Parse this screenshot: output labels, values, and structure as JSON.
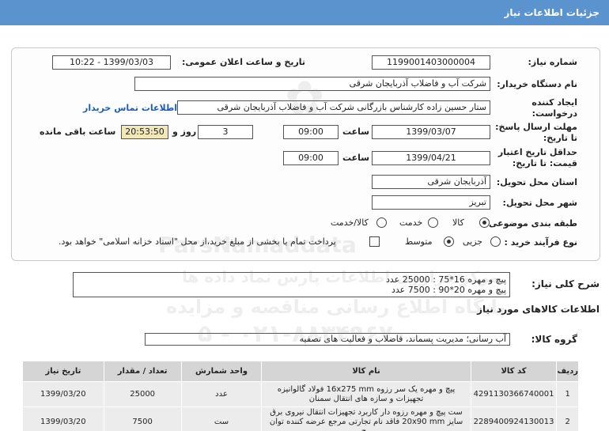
{
  "header": {
    "title": "جزئیات اطلاعات نیاز"
  },
  "form": {
    "need_number_label": "شماره نیاز:",
    "need_number": "1199001403000004",
    "announce_label": "تاریخ و ساعت اعلان عمومی:",
    "announce_value": "1399/03/03 - 10:22",
    "buyer_label": "نام دستگاه خریدار:",
    "buyer_value": "شرکت آب و فاضلاب آذربایجان شرقی",
    "creator_label_1": "ایجاد کننده",
    "creator_label_2": "درخواست:",
    "creator_value": "ستار حسین زاده کارشناس بازرگانی شرکت آب و فاضلاب آذربایجان شرقی",
    "contact_link": "اطلاعات تماس خریدار",
    "reply_label_1": "مهلت ارسال پاسخ:",
    "reply_label_2": "تا تاریخ:",
    "reply_date": "1399/03/07",
    "time_label": "ساعت",
    "reply_time": "09:00",
    "days_value": "3",
    "days_label": "روز و",
    "remaining_time": "20:53:50",
    "remaining_label": "ساعت باقی مانده",
    "validity_label_1": "حداقل تاریخ اعتبار",
    "validity_label_2": "قیمت: تا تاریخ:",
    "validity_date": "1399/04/21",
    "validity_time": "09:00",
    "province_label": "استان محل تحویل:",
    "province_value": "آذربایجان شرقی",
    "city_label": "شهر محل تحویل:",
    "city_value": "تبریز",
    "category_label": "طبقه بندی موضوعی:",
    "category_options": [
      "کالا",
      "خدمت",
      "کالا/خدمت"
    ],
    "process_label": "نوع فرآیند خرید :",
    "process_options": [
      "جزیی",
      "متوسط"
    ],
    "treasury_note": "پرداخت تمام یا بخشی از مبلغ خرید،از محل \"اسناد خزانه اسلامی\" خواهد بود."
  },
  "description": {
    "label": "شرح کلی نیاز:",
    "line1": "پیچ و مهره 16*75 : 25000 عدد",
    "line2": "پیچ و مهره 20*90 : 7500 عدد"
  },
  "goods": {
    "section_title": "اطلاعات کالاهای مورد نیاز",
    "group_label": "گروه کالا:",
    "group_value": "آب رسانی؛ مدیریت پسماند، فاضلاب و فعالیت های تصفیه"
  },
  "table": {
    "headers": [
      "ردیف",
      "کد کالا",
      "نام کالا",
      "واحد شمارش",
      "تعداد / مقدار",
      "تاریخ نیاز"
    ],
    "rows": [
      [
        "1",
        "4291130366740001",
        "پیچ و مهره یک سر رزوه 16x275 mm فولاد گالوانیزه تجهیزات و سازه های انتقال سمنان",
        "عدد",
        "25000",
        "1399/03/20"
      ],
      [
        "2",
        "2289400924130013",
        "ست پیچ و مهره رزوه دار کاربرد تجهیزات انتقال نیروی برق سایز 20x90 mm فاقد نام تجارتی مرجع عرضه کننده توان پیچ",
        "ست",
        "7500",
        "1399/03/20"
      ]
    ]
  },
  "watermark": {
    "line1": "مرکز فراوری اطلاعات پارس نماد داده ها",
    "line2": "پایگاه اطلاع رسانی مناقصه و مزایده",
    "line3": "۰۲۱-۸۸۳۴۹۶۷۰ - ۵",
    "brand": "ParsNamaddata"
  },
  "colors": {
    "header": "#5b93cf",
    "link": "#1a5dbf",
    "timer": "#f2e7b8"
  }
}
